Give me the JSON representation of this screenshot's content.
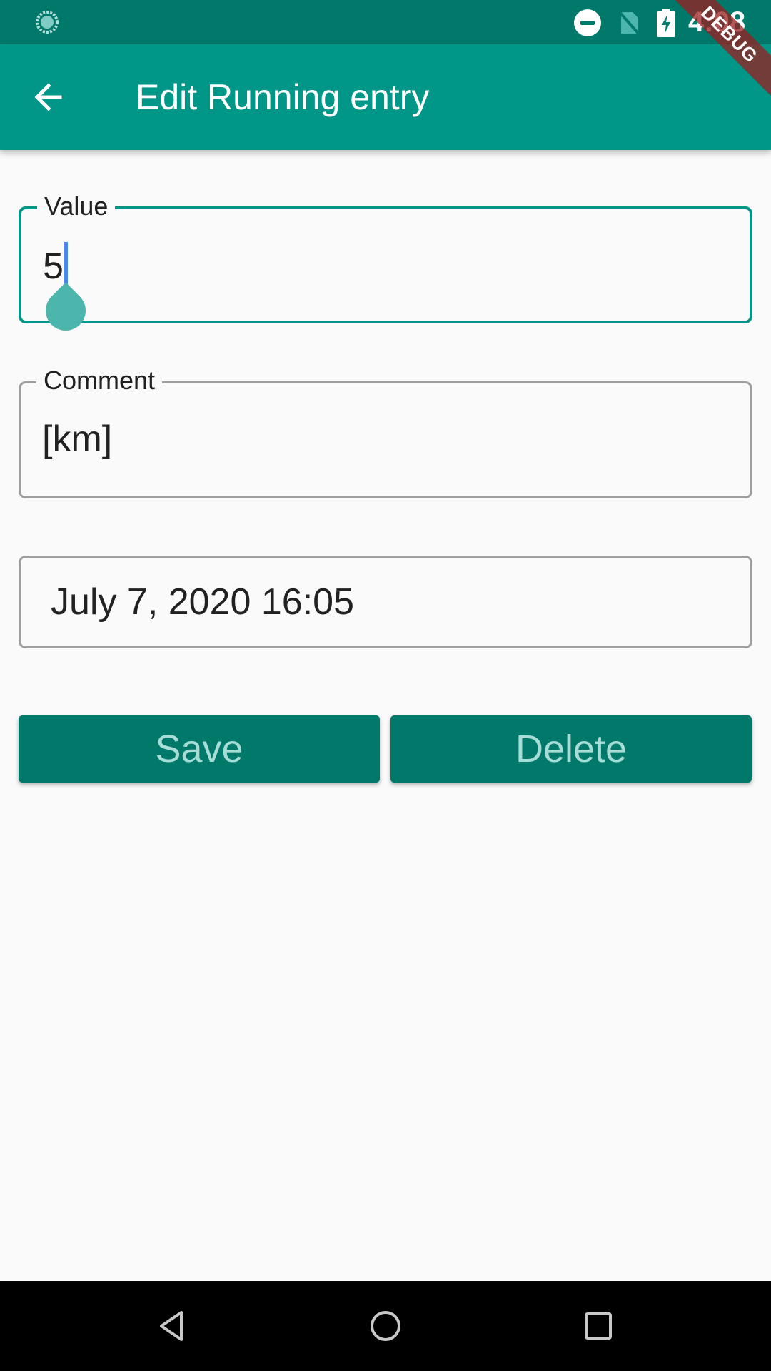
{
  "status_bar": {
    "time": "4:08",
    "icons": [
      "loading-icon",
      "do-not-disturb-icon",
      "no-sim-icon",
      "battery-charging-icon"
    ]
  },
  "debug_banner": "DEBUG",
  "app_bar": {
    "title": "Edit Running entry",
    "back_icon": "arrow-back-icon"
  },
  "form": {
    "value_field": {
      "label": "Value",
      "value": "5"
    },
    "comment_field": {
      "label": "Comment",
      "value": "[km]"
    },
    "datetime_field": {
      "value": "July 7, 2020 16:05"
    }
  },
  "buttons": {
    "save_label": "Save",
    "delete_label": "Delete"
  },
  "nav_bar": {
    "icons": [
      "back-triangle-icon",
      "home-circle-icon",
      "recents-square-icon"
    ]
  },
  "colors": {
    "primary": "#009688",
    "primary_dark": "#00796b",
    "button_text": "#a7ddd6",
    "cursor": "#4a86f2",
    "cursor_handle": "#4db6ac"
  }
}
